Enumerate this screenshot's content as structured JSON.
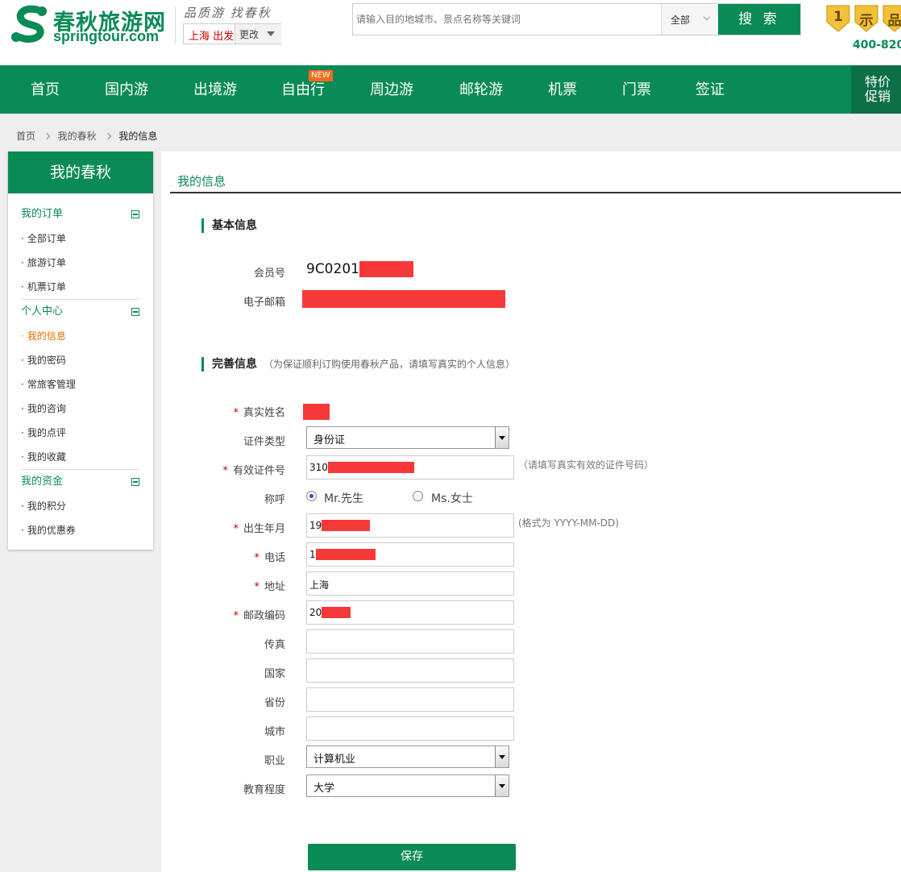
{
  "header": {
    "logo_cn": "春秋旅游网",
    "logo_en": "springtour.com",
    "slogan": "品质游 找春秋",
    "city": "上海 出发",
    "city_change": "更改",
    "search_placeholder": "请输入目的地城市、景点名称等关键词",
    "search_scope": "全部",
    "search_button": "搜 索",
    "badges": [
      "1",
      "示",
      "品"
    ],
    "phone": "400-820-"
  },
  "nav": {
    "items": [
      "首页",
      "国内游",
      "出境游",
      "自由行",
      "周边游",
      "邮轮游",
      "机票",
      "门票",
      "签证"
    ],
    "new_badge": "NEW",
    "special": [
      "特价",
      "促销"
    ]
  },
  "breadcrumb": [
    "首页",
    "我的春秋",
    "我的信息"
  ],
  "sidebar": {
    "title": "我的春秋",
    "groups": [
      {
        "title": "我的订单",
        "items": [
          "全部订单",
          "旅游订单",
          "机票订单"
        ]
      },
      {
        "title": "个人中心",
        "items": [
          "我的信息",
          "我的密码",
          "常旅客管理",
          "我的咨询",
          "我的点评",
          "我的收藏"
        ]
      },
      {
        "title": "我的资金",
        "items": [
          "我的积分",
          "我的优惠券"
        ]
      }
    ],
    "active_item": "我的信息"
  },
  "main": {
    "title": "我的信息",
    "basic_section": "基本信息",
    "member_label": "会员号",
    "member_value": "9C0201",
    "email_label": "电子邮箱",
    "detail_section": "完善信息",
    "detail_note": "（为保证顺利订购使用春秋产品，请填写真实的个人信息）",
    "fields": {
      "real_name": {
        "label": "真实姓名"
      },
      "id_type": {
        "label": "证件类型",
        "value": "身份证"
      },
      "id_number": {
        "label": "有效证件号",
        "value": "310",
        "hint": "（请填写真实有效的证件号码）"
      },
      "salutation": {
        "label": "称呼",
        "option_mr": "Mr.先生",
        "option_ms": "Ms.女士",
        "selected": "Mr.先生"
      },
      "birth": {
        "label": "出生年月",
        "value": "19",
        "hint": "(格式为 YYYY-MM-DD)"
      },
      "phone": {
        "label": "电话",
        "value": "1"
      },
      "address": {
        "label": "地址",
        "value": "上海"
      },
      "postcode": {
        "label": "邮政编码",
        "value": "20"
      },
      "fax": {
        "label": "传真",
        "value": ""
      },
      "country": {
        "label": "国家",
        "value": ""
      },
      "province": {
        "label": "省份",
        "value": ""
      },
      "city": {
        "label": "城市",
        "value": ""
      },
      "occupation": {
        "label": "职业",
        "value": "计算机业"
      },
      "education": {
        "label": "教育程度",
        "value": "大学"
      }
    },
    "save_button": "保存"
  },
  "colors": {
    "brand_green": "#0a8a55",
    "active_orange": "#e07000",
    "redaction": "#f73838",
    "required": "#cc0000"
  }
}
